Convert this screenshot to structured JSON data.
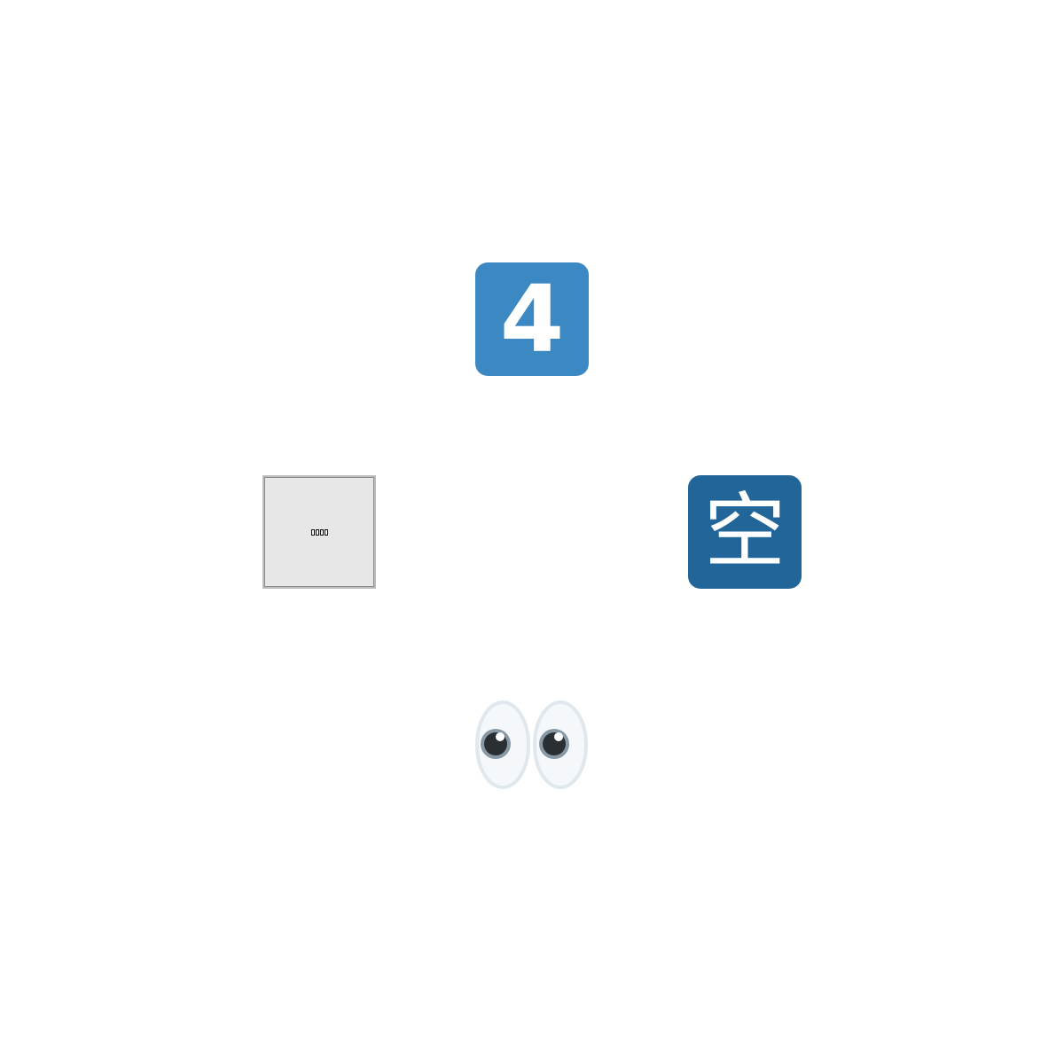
{
  "emojis": {
    "keycap": {
      "digit": "4",
      "color": "#3b88c3"
    },
    "missing_glyph": {
      "box_count": 4,
      "background": "#e7e7e7"
    },
    "vacancy": {
      "char": "空",
      "color": "#269"
    },
    "eyes": {
      "icon": "eyes-icon",
      "sclera_color": "#f5f8fa",
      "outline_color": "#e1e8ed",
      "iris_color": "#8899a6",
      "pupil_color": "#292f33"
    }
  }
}
